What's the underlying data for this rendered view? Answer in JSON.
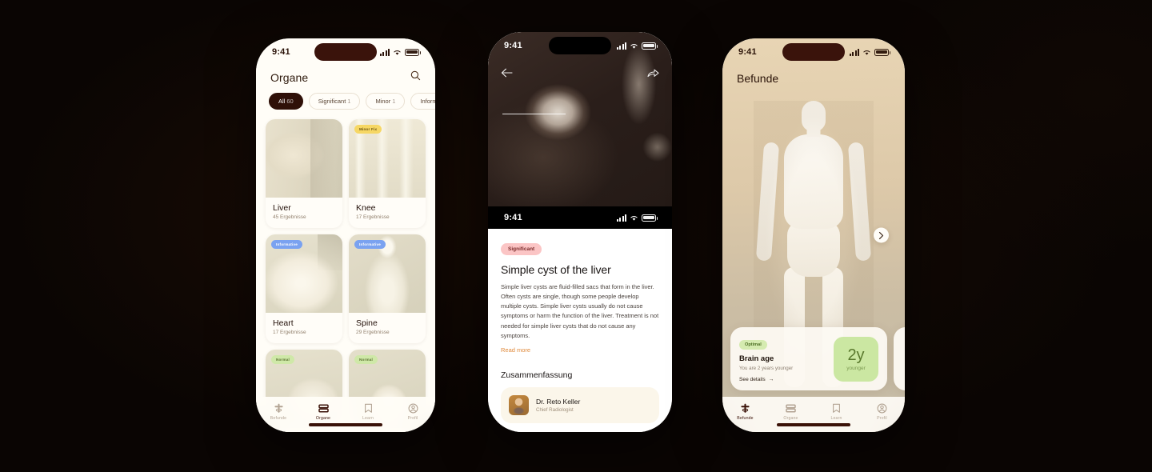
{
  "backdrop": {
    "color": "#0a0503"
  },
  "status_bar": {
    "time": "9:41",
    "icons": [
      "cellular-signal",
      "wifi",
      "battery"
    ]
  },
  "phone1": {
    "name": "organs-list-screen",
    "title": "Organe",
    "search_icon": "search-icon",
    "filters": [
      {
        "label": "All",
        "count": "60",
        "active": true
      },
      {
        "label": "Significant",
        "count": "1",
        "active": false
      },
      {
        "label": "Minor",
        "count": "1",
        "active": false
      },
      {
        "label": "Informative",
        "count": "",
        "active": false
      }
    ],
    "cards": [
      {
        "name": "Liver",
        "results": "45 Ergebnisse",
        "badge": "",
        "badge_type": "",
        "tex": "liver"
      },
      {
        "name": "Knee",
        "results": "17 Ergebnisse",
        "badge": "Minor Fix",
        "badge_type": "minor",
        "tex": "knee"
      },
      {
        "name": "Heart",
        "results": "17 Ergebnisse",
        "badge": "Informative",
        "badge_type": "info",
        "tex": "heart"
      },
      {
        "name": "Spine",
        "results": "29 Ergebnisse",
        "badge": "Informative",
        "badge_type": "info",
        "tex": "spine"
      },
      {
        "name": "",
        "results": "",
        "badge": "Normal",
        "badge_type": "normal",
        "tex": "soft1"
      },
      {
        "name": "",
        "results": "",
        "badge": "Normal",
        "badge_type": "normal",
        "tex": "soft2"
      }
    ],
    "tabs": [
      {
        "label": "Befunde",
        "icon": "organ-icon",
        "active": false
      },
      {
        "label": "Organe",
        "icon": "layers-icon",
        "active": true
      },
      {
        "label": "Learn",
        "icon": "bookmark-icon",
        "active": false
      },
      {
        "label": "Profil",
        "icon": "profile-icon",
        "active": false
      }
    ]
  },
  "phone2": {
    "name": "finding-detail-screen",
    "back_icon": "back-arrow-icon",
    "share_icon": "share-icon",
    "scan_label": "mri-scan-image",
    "severity": "Significant",
    "title": "Simple cyst of the liver",
    "body": "Simple liver cysts are fluid-filled sacs that form in the liver. Often cysts are single, though some people develop multiple cysts. Simple liver cysts usually do not cause symptoms or harm the function of the liver. Treatment is not needed for simple liver cysts that do not cause any symptoms.",
    "read_more": "Read more",
    "section_title": "Zusammenfassung",
    "doctor": {
      "name": "Dr. Reto Keller",
      "role": "Chief Radiologist"
    }
  },
  "phone3": {
    "name": "findings-overview-screen",
    "title": "Befunde",
    "body_model": "human-body-3d-model",
    "metric": {
      "badge": "Optimal",
      "title": "Brain age",
      "subtitle": "You are 2 years younger",
      "link": "See details",
      "link_arrow": "→",
      "value": "2y",
      "unit": "younger"
    },
    "next_icon": "chevron-right-icon",
    "tabs": [
      {
        "label": "Befunde",
        "icon": "organ-icon",
        "active": true
      },
      {
        "label": "Organe",
        "icon": "layers-icon",
        "active": false
      },
      {
        "label": "Learn",
        "icon": "bookmark-icon",
        "active": false
      },
      {
        "label": "Profil",
        "icon": "profile-icon",
        "active": false
      }
    ]
  }
}
